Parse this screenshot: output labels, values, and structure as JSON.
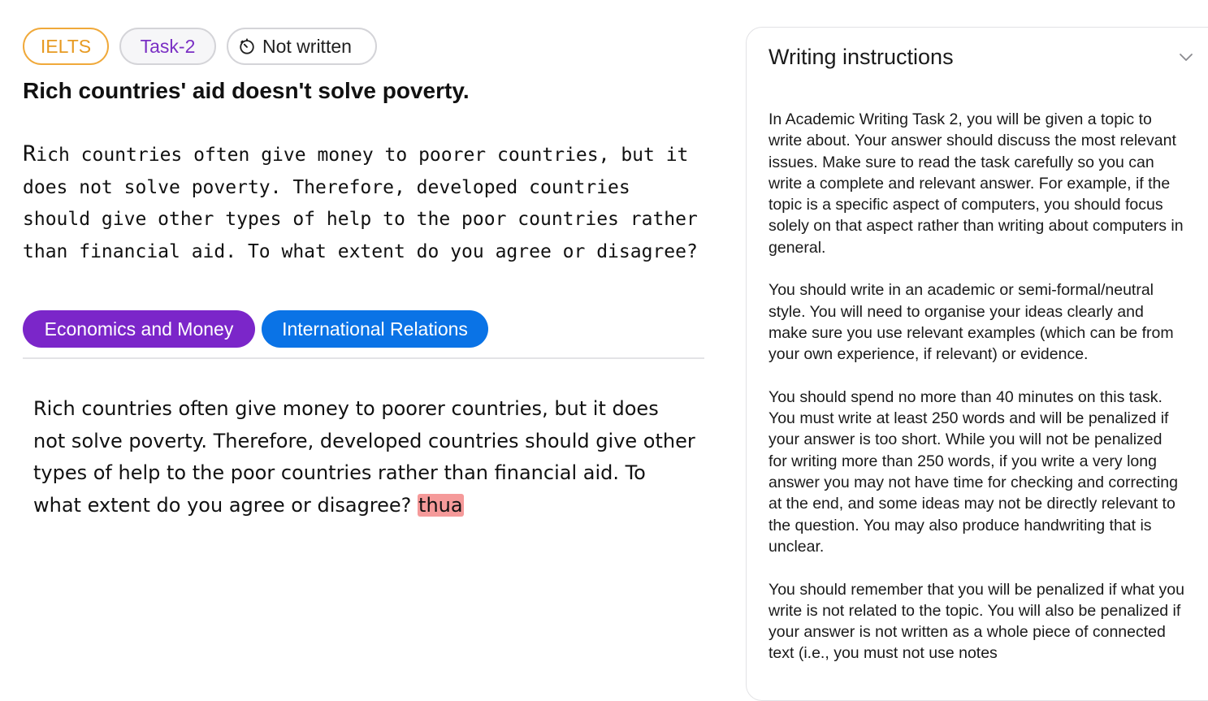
{
  "tags": {
    "exam": "IELTS",
    "task": "Task-2",
    "status": "Not written",
    "status_icon": "timer-icon"
  },
  "title": "Rich countries' aid doesn't solve poverty.",
  "prompt": {
    "first_letter": "R",
    "rest": "ich countries often give money to poorer countries, but it does not solve poverty. Therefore, developed countries should give other types of help to the poor countries rather than financial aid. To what extent do you agree or disagree?"
  },
  "topics": [
    {
      "label": "Economics and Money",
      "color": "#7b26c9"
    },
    {
      "label": "International Relations",
      "color": "#0a73e6"
    }
  ],
  "essay": {
    "text": "Rich countries often give money to poorer countries, but it does not solve poverty. Therefore, developed countries should give other types of help to the poor countries rather than financial aid. To what extent do you agree or disagree? ",
    "flagged_word": "thua"
  },
  "instructions": {
    "title": "Writing instructions",
    "toggle_icon": "chevron-down-icon",
    "paragraphs": [
      "In Academic Writing Task 2, you will be given a topic to write about. Your answer should discuss the most relevant issues. Make sure to read the task carefully so you can write a complete and relevant answer. For example, if the topic is a specific aspect of computers, you should focus solely on that aspect rather than writing about computers in general.",
      "You should write in an academic or semi-formal/neutral style. You will need to organise your ideas clearly and make sure you use relevant examples (which can be from your own experience, if relevant) or evidence.",
      "You should spend no more than 40 minutes on this task. You must write at least 250 words and will be penalized if your answer is too short. While you will not be penalized for writing more than 250 words, if you write a very long answer you may not have time for checking and correcting at the end, and some ideas may not be directly relevant to the question. You may also produce handwriting that is unclear.",
      "You should remember that you will be penalized if what you write is not related to the topic. You will also be penalized if your answer is not written as a whole piece of connected text (i.e., you must not use notes"
    ]
  }
}
